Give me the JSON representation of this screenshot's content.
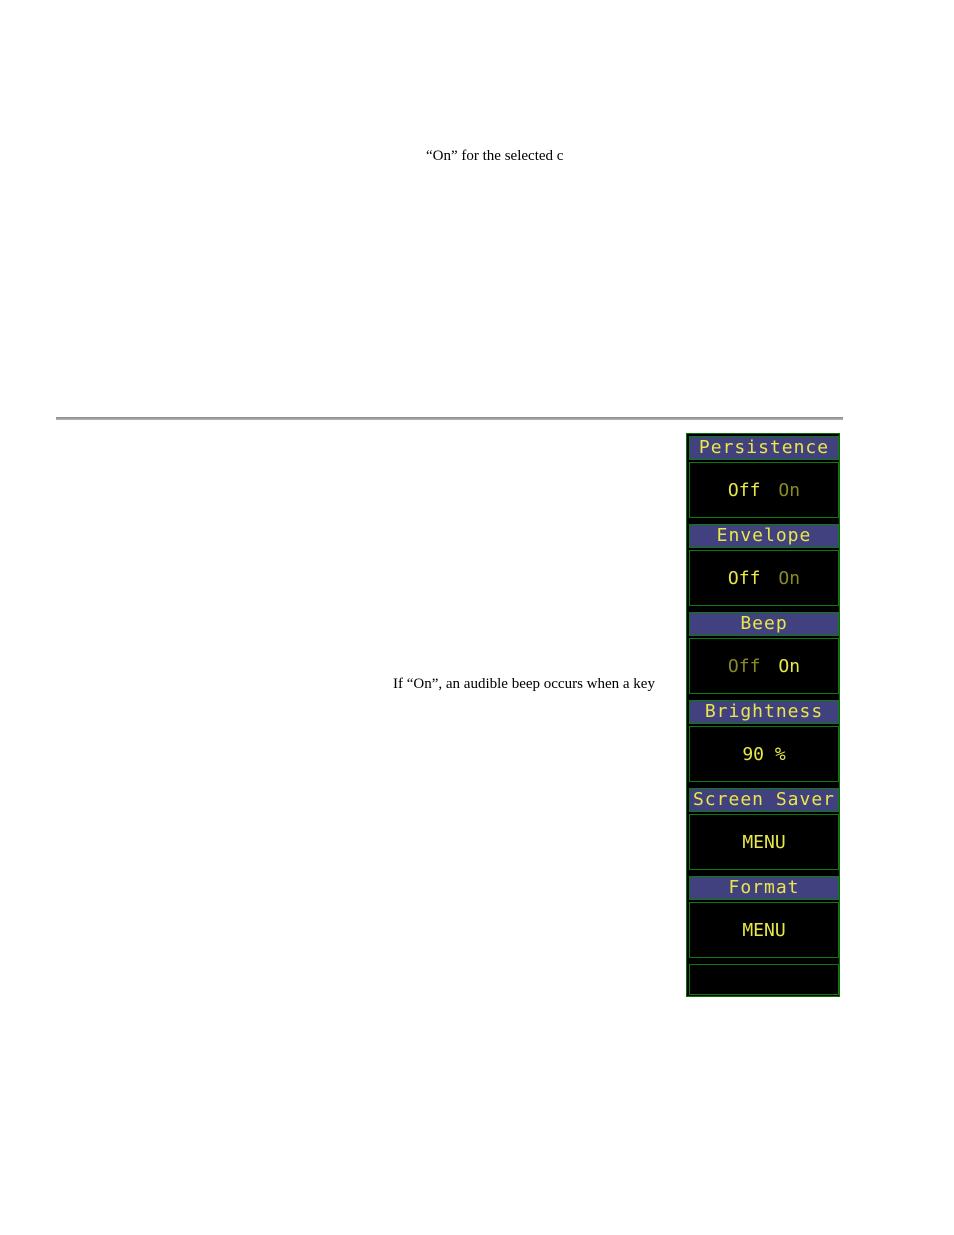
{
  "document": {
    "text_fragment_1": "“On” for the selected c",
    "text_fragment_2": "If “On”, an audible beep occurs when a key"
  },
  "menu_panel": {
    "colors": {
      "header_bg": "#41417f",
      "text": "#e8e848",
      "border": "#0e7a0e",
      "body_bg": "#000000"
    },
    "sections": [
      {
        "title": "Persistence",
        "options": [
          "Off",
          "On"
        ],
        "selected": "Off"
      },
      {
        "title": "Envelope",
        "options": [
          "Off",
          "On"
        ],
        "selected": "Off"
      },
      {
        "title": "Beep",
        "options": [
          "Off",
          "On"
        ],
        "selected": "On"
      },
      {
        "title": "Brightness",
        "value": "90 %"
      },
      {
        "title": "Screen Saver",
        "value": "MENU"
      },
      {
        "title": "Format",
        "value": "MENU"
      }
    ]
  }
}
